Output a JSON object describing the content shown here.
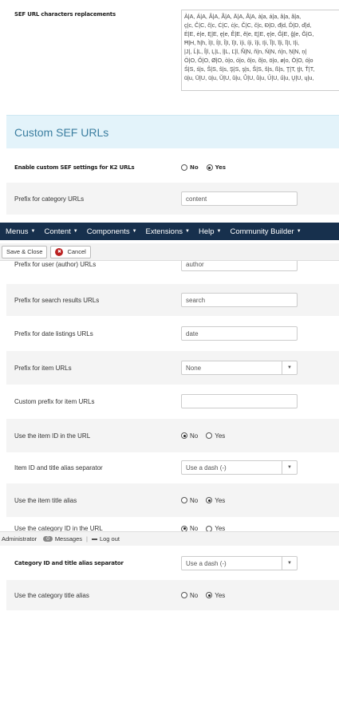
{
  "sef_replacements": {
    "label": "SEF URL characters replacements",
    "lines": [
      "À|A, Á|A, Â|A, Ã|A, Ä|A, Å|A, à|a, á|a, â|a, ã|a,",
      "ç|c, Ĉ|C, ĉ|c, Ċ|C, ċ|c, Č|C, č|c, Đ|D, đ|d, Ď|D, ď|d,",
      "Ė|E, ė|e, Ę|E, ę|e, Ě|E, ě|e, Ę|E, ę|e, Ĝ|E, ĝ|e, Ğ|G,",
      "Ħ|H, ħ|h, Ì|I, Í|I, Î|I, Ï|I, ì|i, í|i, î|i, ï|i, Ĩ|I, ĩ|i, Ī|I, ī|i,",
      "|J|, Ĺ|L, ĺ|l, Ļ|L, ļ|L, Ľ|l, Ñ|N, ñ|n, Ń|N, ń|n, Ņ|N, ņ|",
      "Ö|O, Ő|O, Ø|O, ò|o, ó|o, ô|o, õ|o, ö|o, ø|o, Ò|O, ó|o",
      "Ś|S, ś|s, Ŝ|S, ŝ|s, Ş|S, ş|s, Š|S, š|s, ß|s, Ţ|T, ţ|t, Ť|T,",
      "ū|u, Ū|U, ū|u, Ŭ|U, ŭ|u, Ů|U, ů|u, Ű|U, ű|u, Ų|U, ų|u,"
    ]
  },
  "section_title": "Custom SEF URLs",
  "enable_custom": {
    "label": "Enable custom SEF settings for K2 URLs",
    "no": "No",
    "yes": "Yes",
    "selected": "yes"
  },
  "prefix_category": {
    "label": "Prefix for category URLs",
    "value": "content"
  },
  "prefix_user": {
    "label": "Prefix for user (author) URLs",
    "value": "author"
  },
  "navbar": {
    "items": [
      {
        "label": "Menus",
        "caret": "▼"
      },
      {
        "label": "Content",
        "caret": "▼"
      },
      {
        "label": "Components",
        "caret": "▼"
      },
      {
        "label": "Extensions",
        "caret": "▼"
      },
      {
        "label": "Help",
        "caret": "▼"
      },
      {
        "label": "Community Builder",
        "caret": "▼"
      }
    ]
  },
  "toolbar": {
    "save_close": "Save & Close",
    "cancel": "Cancel",
    "cancel_icon": "✖"
  },
  "prefix_search": {
    "label": "Prefix for search results URLs",
    "value": "search"
  },
  "prefix_date": {
    "label": "Prefix for date listings URLs",
    "value": "date"
  },
  "prefix_item": {
    "label": "Prefix for item URLs",
    "value": "None",
    "arrow": "▼"
  },
  "custom_prefix_item": {
    "label": "Custom prefix for item URLs",
    "value": ""
  },
  "use_item_id": {
    "label": "Use the item ID in the URL",
    "no": "No",
    "yes": "Yes",
    "selected": "no"
  },
  "item_separator": {
    "label": "Item ID and title alias separator",
    "value": "Use a dash (-)",
    "arrow": "▼"
  },
  "use_item_alias": {
    "label": "Use the item title alias",
    "no": "No",
    "yes": "Yes",
    "selected": "yes"
  },
  "use_category_id": {
    "label": "Use the category ID in the URL",
    "no": "No",
    "yes": "Yes",
    "selected": "no"
  },
  "statusbar": {
    "user": "Administrator",
    "messages_count": "0",
    "messages": "Messages",
    "separator": "|",
    "logout": "Log out"
  },
  "category_separator": {
    "label": "Category ID and title alias separator",
    "value": "Use a dash (-)",
    "arrow": "▼"
  },
  "use_category_alias": {
    "label": "Use the category title alias",
    "no": "No",
    "yes": "Yes",
    "selected": "yes"
  }
}
